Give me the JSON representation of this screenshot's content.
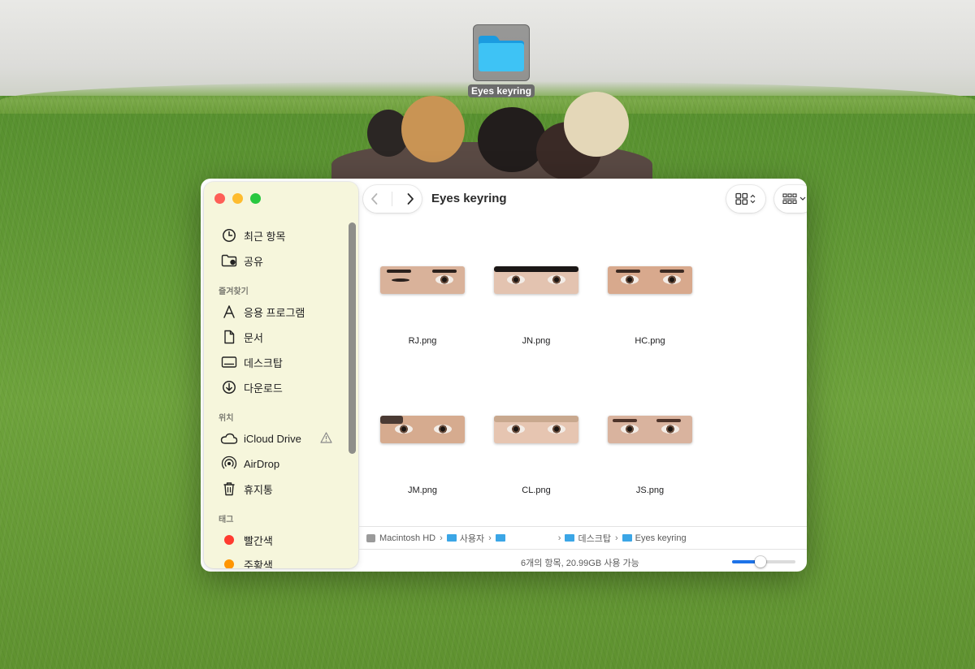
{
  "desktop": {
    "folder_label": "Eyes keyring"
  },
  "window": {
    "title": "Eyes keyring",
    "toolbar": {
      "back_icon": "chevron-left-icon",
      "forward_icon": "chevron-right-icon",
      "view_icon": "grid-view-icon",
      "group_icon": "group-by-icon",
      "share_icon": "share-icon",
      "tag_icon": "tag-icon",
      "more_icon": "ellipsis-icon",
      "search_icon": "search-icon"
    },
    "sidebar": {
      "top_items": [
        {
          "label": "최근 항목",
          "icon": "clock-icon"
        },
        {
          "label": "공유",
          "icon": "shared-folder-icon"
        }
      ],
      "favorites_heading": "즐겨찾기",
      "favorites": [
        {
          "label": "응용 프로그램",
          "icon": "applications-icon"
        },
        {
          "label": "문서",
          "icon": "document-icon"
        },
        {
          "label": "데스크탑",
          "icon": "desktop-icon"
        },
        {
          "label": "다운로드",
          "icon": "download-icon"
        }
      ],
      "locations_heading": "위치",
      "locations": [
        {
          "label": "iCloud Drive",
          "icon": "cloud-icon"
        },
        {
          "label": "AirDrop",
          "icon": "airdrop-icon"
        },
        {
          "label": "휴지통",
          "icon": "trash-icon"
        }
      ],
      "tags_heading": "태그",
      "tags": [
        {
          "label": "빨간색",
          "color": "#ff3b30"
        },
        {
          "label": "주황색",
          "color": "#ff9500"
        }
      ]
    },
    "files": [
      {
        "name": "RJ.png",
        "tone": "#d9b29a"
      },
      {
        "name": "JN.png",
        "tone": "#e3c3b0"
      },
      {
        "name": "HC.png",
        "tone": "#d8a98d"
      },
      {
        "name": "JM.png",
        "tone": "#d6ab8f"
      },
      {
        "name": "CL.png",
        "tone": "#e6c5b1"
      },
      {
        "name": "JS.png",
        "tone": "#d9b39e"
      }
    ],
    "path": [
      "Macintosh HD",
      "사용자",
      "",
      "데스크탑",
      "Eyes keyring"
    ],
    "status": "6개의 항목, 20.99GB 사용 가능",
    "icon_size_level": 0.45
  }
}
